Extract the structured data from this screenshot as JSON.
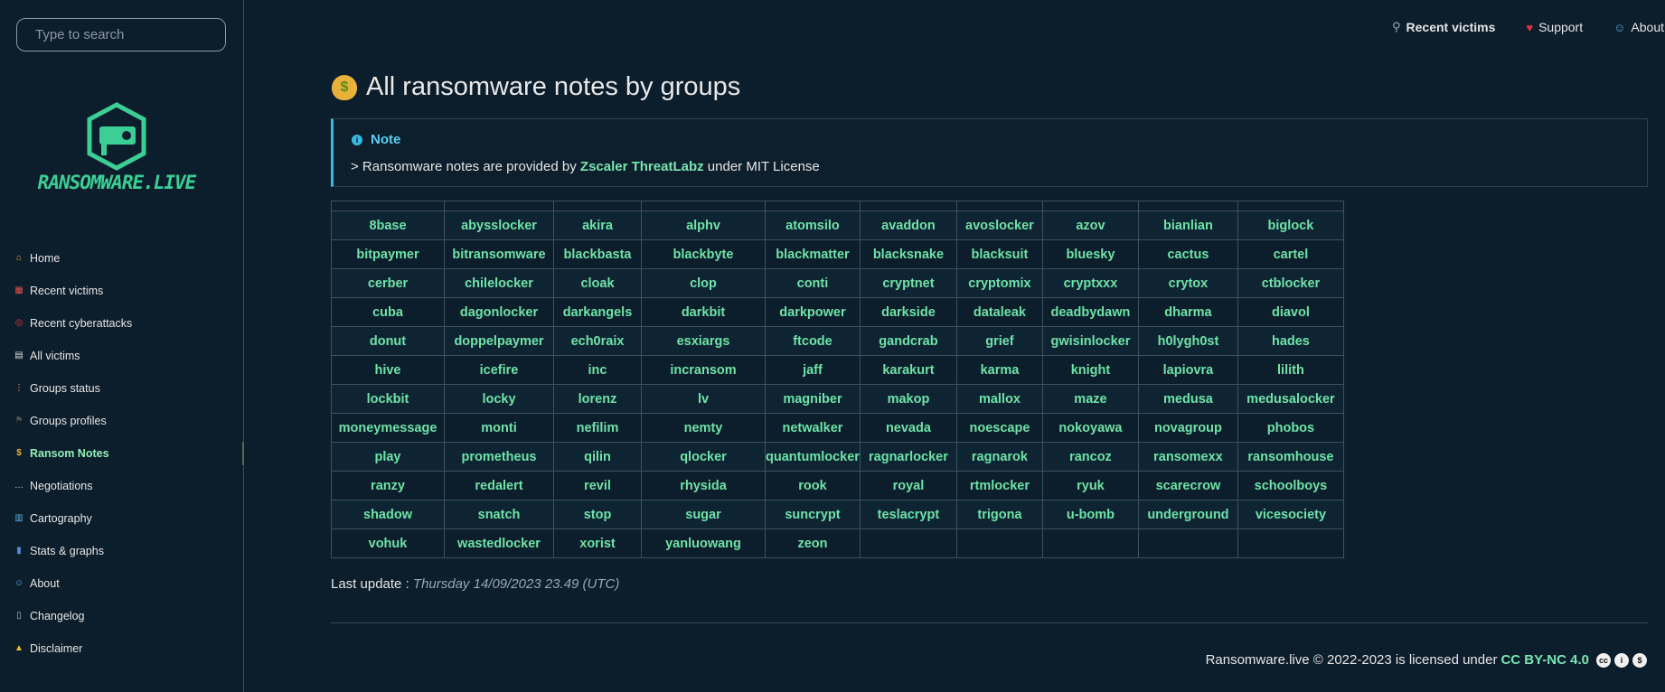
{
  "sidebar": {
    "search_placeholder": "Type to search",
    "logo_text": "RANSOMWARE.LIVE",
    "items": [
      {
        "label": "Home",
        "icon": "house-icon",
        "color": "#e8a33a"
      },
      {
        "label": "Recent victims",
        "icon": "calendar-icon",
        "color": "#e05050"
      },
      {
        "label": "Recent cyberattacks",
        "icon": "target-icon",
        "color": "#e04040"
      },
      {
        "label": "All victims",
        "icon": "page-icon",
        "color": "#dddddd"
      },
      {
        "label": "Groups status",
        "icon": "traffic-light-icon",
        "color": "#e8b23a"
      },
      {
        "label": "Groups profiles",
        "icon": "flag-icon",
        "color": "#555555"
      },
      {
        "label": "Ransom Notes",
        "icon": "money-bag-icon",
        "color": "#e8b23a"
      },
      {
        "label": "Negotiations",
        "icon": "speech-bubble-icon",
        "color": "#dddddd"
      },
      {
        "label": "Cartography",
        "icon": "map-icon",
        "color": "#5aaad8"
      },
      {
        "label": "Stats & graphs",
        "icon": "bar-chart-icon",
        "color": "#5a8ad8"
      },
      {
        "label": "About",
        "icon": "technologist-icon",
        "color": "#5aaad8"
      },
      {
        "label": "Changelog",
        "icon": "pager-icon",
        "color": "#bbbbbb"
      },
      {
        "label": "Disclaimer",
        "icon": "warning-icon",
        "color": "#f0c020"
      }
    ],
    "active_index": 6
  },
  "topnav": [
    {
      "label": "Recent victims",
      "icon": "magnifier-icon",
      "bold": true
    },
    {
      "label": "Support",
      "icon": "heart-icon",
      "bold": false
    },
    {
      "label": "About",
      "icon": "technologist-icon",
      "bold": false
    }
  ],
  "page": {
    "title": "All ransomware notes by groups",
    "note_heading": "Note",
    "note_prefix": "> Ransomware notes are provided by",
    "note_link": "Zscaler ThreatLabz",
    "note_suffix": "under MIT License",
    "last_update_label": "Last update :",
    "last_update_value": "Thursday 14/09/2023 23.49 (UTC)"
  },
  "groups": [
    [
      "8base",
      "abysslocker",
      "akira",
      "alphv",
      "atomsilo",
      "avaddon",
      "avoslocker",
      "azov",
      "bianlian",
      "biglock"
    ],
    [
      "bitpaymer",
      "bitransomware",
      "blackbasta",
      "blackbyte",
      "blackmatter",
      "blacksnake",
      "blacksuit",
      "bluesky",
      "cactus",
      "cartel"
    ],
    [
      "cerber",
      "chilelocker",
      "cloak",
      "clop",
      "conti",
      "cryptnet",
      "cryptomix",
      "cryptxxx",
      "crytox",
      "ctblocker"
    ],
    [
      "cuba",
      "dagonlocker",
      "darkangels",
      "darkbit",
      "darkpower",
      "darkside",
      "dataleak",
      "deadbydawn",
      "dharma",
      "diavol"
    ],
    [
      "donut",
      "doppelpaymer",
      "ech0raix",
      "esxiargs",
      "ftcode",
      "gandcrab",
      "grief",
      "gwisinlocker",
      "h0lygh0st",
      "hades"
    ],
    [
      "hive",
      "icefire",
      "inc",
      "incransom",
      "jaff",
      "karakurt",
      "karma",
      "knight",
      "lapiovra",
      "lilith"
    ],
    [
      "lockbit",
      "locky",
      "lorenz",
      "lv",
      "magniber",
      "makop",
      "mallox",
      "maze",
      "medusa",
      "medusalocker"
    ],
    [
      "moneymessage",
      "monti",
      "nefilim",
      "nemty",
      "netwalker",
      "nevada",
      "noescape",
      "nokoyawa",
      "novagroup",
      "phobos"
    ],
    [
      "play",
      "prometheus",
      "qilin",
      "qlocker",
      "quantumlocker",
      "ragnarlocker",
      "ragnarok",
      "rancoz",
      "ransomexx",
      "ransomhouse"
    ],
    [
      "ranzy",
      "redalert",
      "revil",
      "rhysida",
      "rook",
      "royal",
      "rtmlocker",
      "ryuk",
      "scarecrow",
      "schoolboys"
    ],
    [
      "shadow",
      "snatch",
      "stop",
      "sugar",
      "suncrypt",
      "teslacrypt",
      "trigona",
      "u-bomb",
      "underground",
      "vicesociety"
    ],
    [
      "vohuk",
      "wastedlocker",
      "xorist",
      "yanluowang",
      "zeon",
      "",
      "",
      "",
      "",
      ""
    ]
  ],
  "footer": {
    "text": "Ransomware.live © 2022-2023 is licensed under",
    "license": "CC BY-NC 4.0",
    "badges": [
      "cc-icon",
      "by-icon",
      "nc-icon"
    ]
  },
  "colors": {
    "accent": "#6ee3a8",
    "background": "#0c1d2b",
    "note_border": "#3ab8de"
  }
}
